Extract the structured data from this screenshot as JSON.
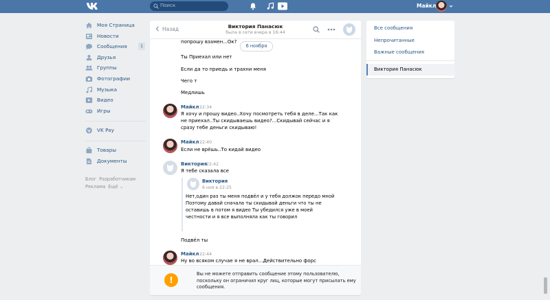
{
  "header": {
    "search_placeholder": "Поиск",
    "user_name": "Майкл"
  },
  "nav": {
    "items": [
      {
        "label": "Моя Страница",
        "icon": "home-icon"
      },
      {
        "label": "Новости",
        "icon": "news-icon"
      },
      {
        "label": "Сообщения",
        "icon": "messages-icon",
        "count": "1"
      },
      {
        "label": "Друзья",
        "icon": "friends-icon"
      },
      {
        "label": "Группы",
        "icon": "groups-icon"
      },
      {
        "label": "Фотографии",
        "icon": "photos-icon"
      },
      {
        "label": "Музыка",
        "icon": "music-icon"
      },
      {
        "label": "Видео",
        "icon": "video-icon"
      },
      {
        "label": "Игры",
        "icon": "games-icon"
      }
    ],
    "pay_label": "VK Pay",
    "extra": [
      {
        "label": "Товары",
        "icon": "goods-icon"
      },
      {
        "label": "Документы",
        "icon": "documents-icon"
      }
    ],
    "footer": [
      "Блог",
      "Разработчикам",
      "Реклама",
      "Ещё ⌄"
    ]
  },
  "chat": {
    "back_label": "Назад",
    "title": "Виктория Панасюк",
    "status": "была в сети вчера в 16:44",
    "partial_top": "попрошу взамен...Ок?",
    "date_divider": "6 ноября",
    "lines": [
      "Ты Приехал или нет",
      "Если да то приедь и трахни меня",
      "Чего т",
      "Медлишь"
    ],
    "messages": [
      {
        "author": "Майкл",
        "time": "22:34",
        "text": "Я хочу и прошу видео..Хочу посмотреть тебя в деле...Так как не приехал..Ты скидываешь видео?...Скидывай сейчас и я сразу тебе деньги скидываю!"
      },
      {
        "author": "Майкл",
        "time": "22:40",
        "text": "Если не врёшь..То кидай видео"
      },
      {
        "author": "Виктория",
        "time": "22:42",
        "text": "Я тебе сказала все"
      },
      {
        "author": "Майкл",
        "time": "22:44",
        "text": "Ну во всяком случае я не врал...Действительно форс мажор..А"
      }
    ],
    "forward": {
      "author": "Виктория",
      "time": "6 ноя в 22:25",
      "text": "Нет,один раз ты меня подвёл и у тебя должок передо мной Поэтому давай сначала ты скидывай деньги что ты не оставишь в потом я видео Ты убедился уже в моей честности и я все выполняла как ты говорил"
    },
    "after_forward": "Подвёл ты",
    "notice": "Вы не можете отправить сообщение этому пользователю, поскольку он ограничил круг лиц, которые могут присылать ему сообщения."
  },
  "right_menu": {
    "all": "Все сообщения",
    "unread": "Непрочитанные",
    "important": "Важные сообщения",
    "selected": "Виктория Панасюк"
  },
  "colors": {
    "brand": "#4a76a8",
    "link": "#2a5885",
    "warning": "#ffa000"
  }
}
